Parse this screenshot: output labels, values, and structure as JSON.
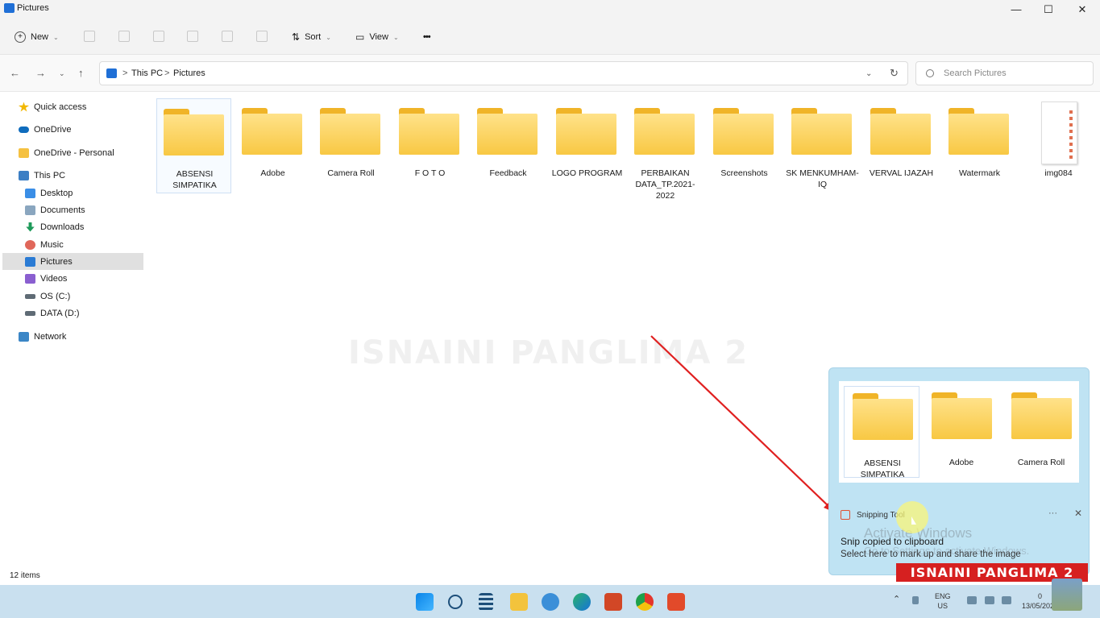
{
  "window": {
    "title": "Pictures",
    "minimize": "—",
    "maximize": "☐",
    "close": "✕"
  },
  "toolbar": {
    "new_label": "New",
    "sort_label": "Sort",
    "view_label": "View",
    "more": "•••"
  },
  "address": {
    "crumbs": [
      "This PC",
      "Pictures"
    ],
    "separator": ">"
  },
  "search": {
    "placeholder": "Search Pictures"
  },
  "sidebar": {
    "items": [
      {
        "label": "Quick access",
        "icon": "star-icon"
      },
      {
        "label": "OneDrive",
        "icon": "cloud-icon"
      },
      {
        "label": "OneDrive - Personal",
        "icon": "folder-icon"
      },
      {
        "label": "This PC",
        "icon": "computer-icon"
      },
      {
        "label": "Desktop",
        "icon": "desktop-icon"
      },
      {
        "label": "Documents",
        "icon": "documents-icon"
      },
      {
        "label": "Downloads",
        "icon": "download-icon"
      },
      {
        "label": "Music",
        "icon": "music-icon"
      },
      {
        "label": "Pictures",
        "icon": "pictures-icon",
        "selected": true
      },
      {
        "label": "Videos",
        "icon": "videos-icon"
      },
      {
        "label": "OS (C:)",
        "icon": "drive-icon"
      },
      {
        "label": "DATA (D:)",
        "icon": "drive-icon"
      },
      {
        "label": "Network",
        "icon": "network-icon"
      }
    ]
  },
  "files": [
    {
      "name": "ABSENSI SIMPATIKA",
      "type": "folder",
      "selected": true
    },
    {
      "name": "Adobe",
      "type": "folder"
    },
    {
      "name": "Camera Roll",
      "type": "folder"
    },
    {
      "name": "F O T O",
      "type": "folder"
    },
    {
      "name": "Feedback",
      "type": "folder"
    },
    {
      "name": "LOGO PROGRAM",
      "type": "folder"
    },
    {
      "name": "PERBAIKAN DATA_TP.2021-2022",
      "type": "folder"
    },
    {
      "name": "Screenshots",
      "type": "folder"
    },
    {
      "name": "SK MENKUMHAM-IQ",
      "type": "folder"
    },
    {
      "name": "VERVAL IJAZAH",
      "type": "folder"
    },
    {
      "name": "Watermark",
      "type": "folder"
    },
    {
      "name": "img084",
      "type": "image"
    }
  ],
  "watermark": "ISNAINI PANGLIMA 2",
  "status": {
    "count": "12 items"
  },
  "toast": {
    "preview": [
      "ABSENSI SIMPATIKA",
      "Adobe",
      "Camera Roll"
    ],
    "app": "Snipping Tool",
    "title": "Snip copied to clipboard",
    "body": "Select here to mark up and share the image",
    "more": "···",
    "close": "✕"
  },
  "activation": {
    "title": "Activate Windows",
    "subtitle": "Go to Settings to activate Windows."
  },
  "banner": "ISNAINI PANGLIMA 2",
  "taskbar": {
    "lang": "ENG",
    "region": "US",
    "date": "13/05/2022",
    "time_fragment": "0"
  },
  "colors": {
    "accent": "#1f6fd6",
    "folder": "#f8c843",
    "banner": "#d62020",
    "toast": "#bfe3f3",
    "arrow": "#e02020"
  }
}
